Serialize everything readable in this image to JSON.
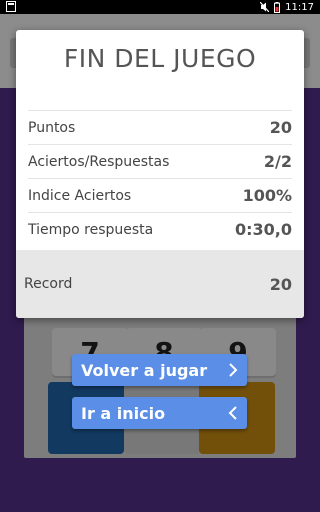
{
  "status_bar": {
    "time": "11:17",
    "icons": [
      "notification-icon",
      "mute-icon",
      "battery-icon"
    ]
  },
  "background": {
    "keys": [
      "7",
      "8",
      "9"
    ],
    "pad_colors": [
      "#1f63a6",
      "#cfcfcf",
      "#c48a12"
    ]
  },
  "dialog": {
    "title": "FIN DEL JUEGO",
    "stats": [
      {
        "label": "Puntos",
        "value": "20"
      },
      {
        "label": "Aciertos/Respuestas",
        "value": "2/2"
      },
      {
        "label": "Indice Aciertos",
        "value": "100%"
      },
      {
        "label": "Tiempo respuesta",
        "value": "0:30,0"
      }
    ],
    "record": {
      "label": "Record",
      "value": "20"
    }
  },
  "buttons": {
    "play_again": {
      "label": "Volver a jugar",
      "icon": "chevron-right-icon"
    },
    "go_home": {
      "label": "Ir a inicio",
      "icon": "chevron-left-icon"
    }
  },
  "colors": {
    "accent_button": "#5b8ee6",
    "app_background": "#512f86"
  }
}
